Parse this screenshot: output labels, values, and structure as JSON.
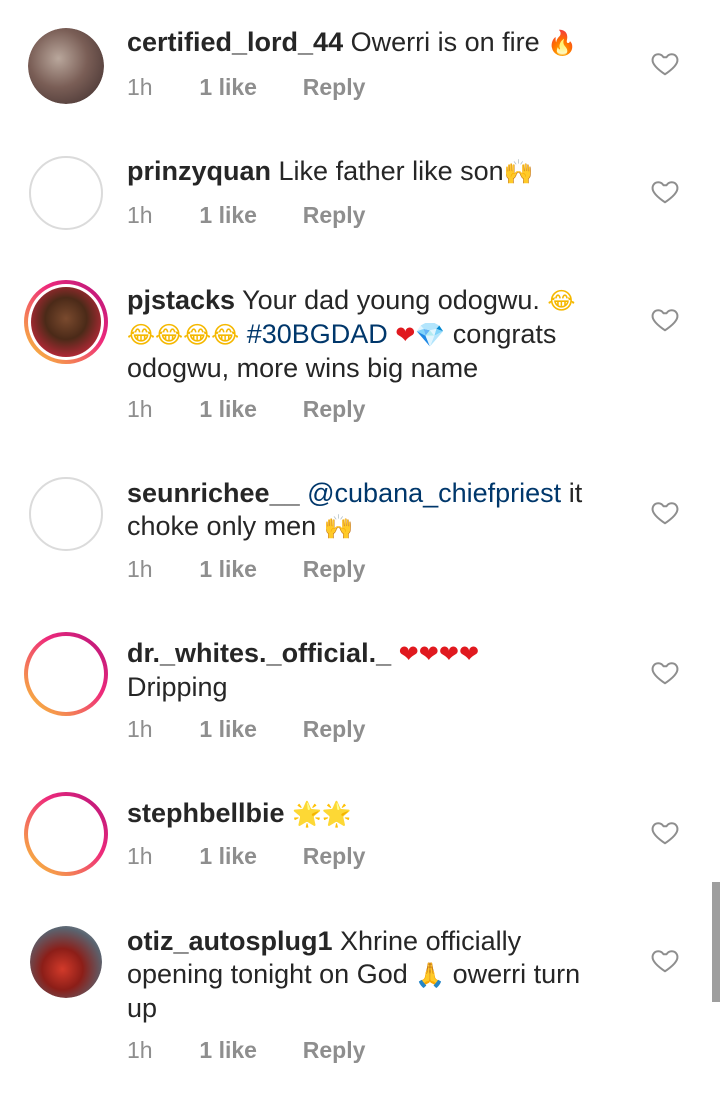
{
  "comments": [
    {
      "username": "certified_lord_44",
      "text": "Owerri is on fire",
      "emoji": "🔥",
      "time": "1h",
      "likes": "1 like",
      "reply": "Reply"
    },
    {
      "username": "prinzyquan",
      "text": "Like father like son",
      "emoji": "🙌",
      "time": "1h",
      "likes": "1 like",
      "reply": "Reply"
    },
    {
      "username": "pjstacks",
      "text_a": "Your dad young odogwu.",
      "emoji_a": "😂",
      "emoji_b": "😂😂😂😂",
      "hashtag": "#30BGDAD",
      "emoji_c": "❤",
      "emoji_d": "💎",
      "text_b": "congrats",
      "text_c": "odogwu, more wins big name",
      "time": "1h",
      "likes": "1 like",
      "reply": "Reply"
    },
    {
      "username": "seunrichee__",
      "mention": "@cubana_chiefpriest",
      "text_a": "it",
      "text_b": "choke only men",
      "emoji": "🙌",
      "time": "1h",
      "likes": "1 like",
      "reply": "Reply"
    },
    {
      "username": "dr._whites._official._",
      "emoji": "❤❤❤❤",
      "text": "Dripping",
      "time": "1h",
      "likes": "1 like",
      "reply": "Reply"
    },
    {
      "username": "stephbellbie",
      "emoji": "🌟🌟",
      "time": "1h",
      "likes": "1 like",
      "reply": "Reply"
    },
    {
      "username": "otiz_autosplug1",
      "text_a": "Xhrine officially",
      "text_b": "opening tonight on God",
      "emoji": "🙏",
      "text_c": "owerri turn",
      "text_d": "up",
      "time": "1h",
      "likes": "1 like",
      "reply": "Reply"
    }
  ],
  "icons": {
    "like": "heart-outline-icon"
  },
  "colors": {
    "link": "#00376b",
    "muted": "#8e8e8e",
    "story_ring_start": "#f9ce34",
    "story_ring_end": "#b0127b"
  }
}
